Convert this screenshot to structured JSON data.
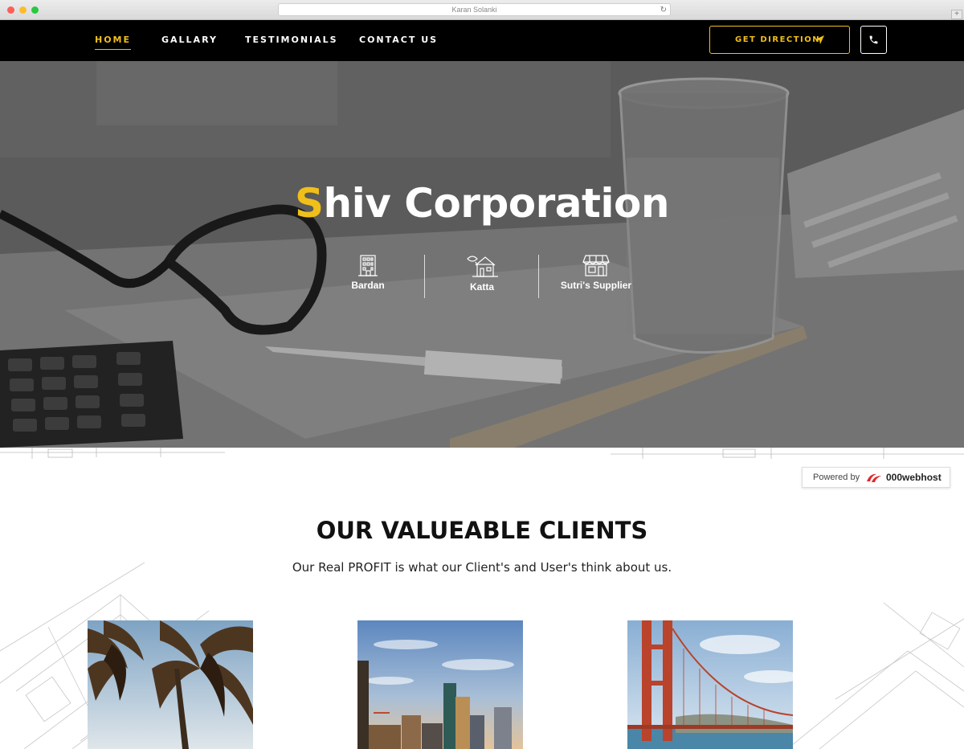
{
  "browser": {
    "url_title": "Karan Solanki"
  },
  "nav": {
    "items": [
      {
        "label": "HOME",
        "active": true
      },
      {
        "label": "GALLARY",
        "active": false
      },
      {
        "label": "TESTIMONIALS",
        "active": false
      },
      {
        "label": "CONTACT US",
        "active": false
      }
    ],
    "direction_button": "GET DIRECTION",
    "phone_icon": "phone-icon"
  },
  "hero": {
    "title_first_letter": "S",
    "title_rest": "hiv Corporation",
    "features": [
      {
        "label": "Bardan",
        "icon": "building-icon"
      },
      {
        "label": "Katta",
        "icon": "house-icon"
      },
      {
        "label": "Sutri's Supplier",
        "icon": "shop-icon"
      }
    ]
  },
  "powered": {
    "prefix": "Powered by",
    "brand": "000webhost"
  },
  "clients": {
    "title": "OUR VALUEABLE CLIENTS",
    "subtitle": "Our Real PROFIT is what our Client's and User's think about us.",
    "cards": [
      {
        "image": "palm-trees-image"
      },
      {
        "image": "city-skyline-image"
      },
      {
        "image": "golden-gate-bridge-image"
      }
    ]
  },
  "colors": {
    "accent": "#f0bf1a",
    "nav_bg": "#000000"
  }
}
